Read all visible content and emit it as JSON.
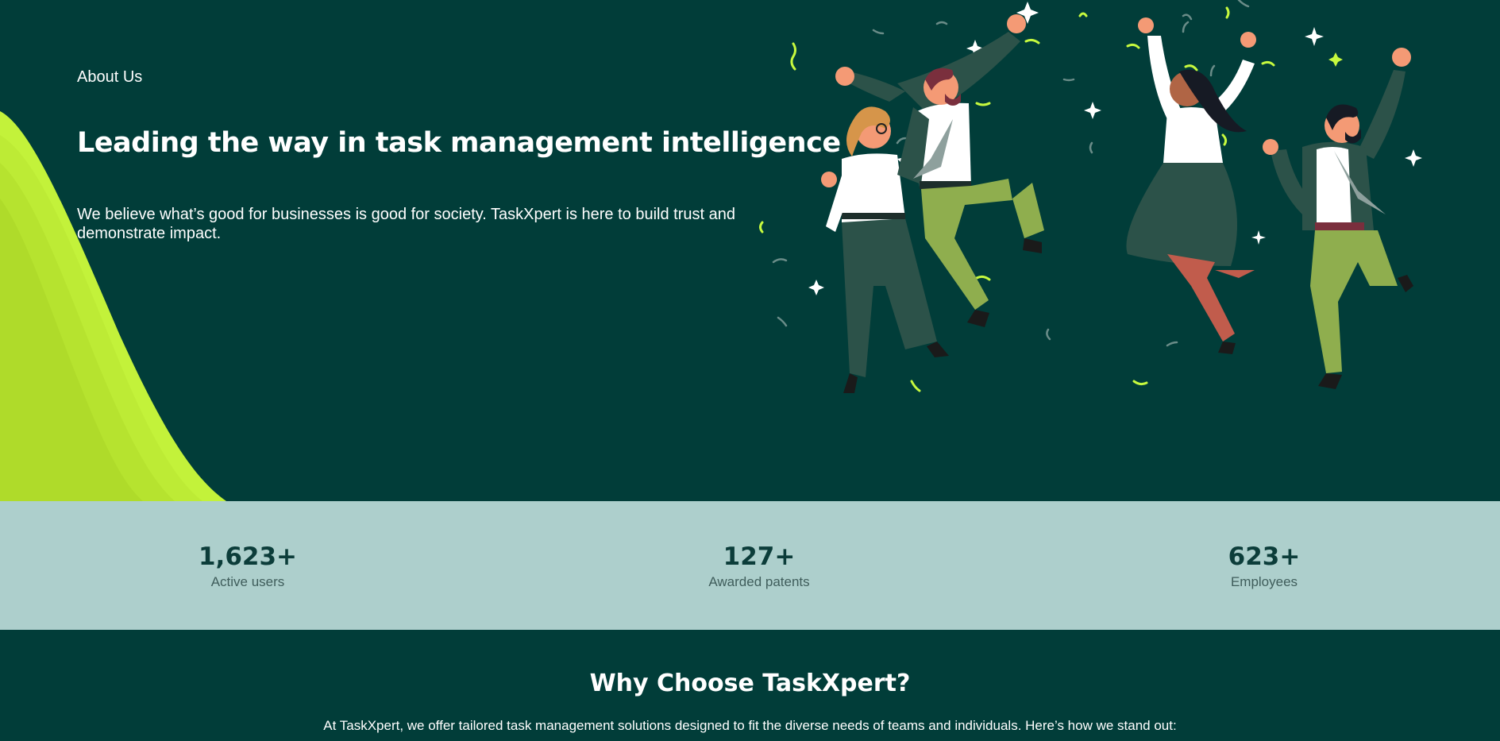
{
  "hero": {
    "eyebrow": "About Us",
    "title": "Leading the way in task management intelligence",
    "description": "We believe what’s good for businesses is good for society. TaskXpert is here to build trust and demonstrate impact.",
    "illustration": "people-jumping-celebration-illustration"
  },
  "stats": [
    {
      "value": "1,623+",
      "label": "Active users"
    },
    {
      "value": "127+",
      "label": "Awarded patents"
    },
    {
      "value": "623+",
      "label": "Employees"
    }
  ],
  "why": {
    "title": "Why Choose TaskXpert?",
    "intro": "At TaskXpert, we offer tailored task management solutions designed to fit the diverse needs of teams and individuals. Here’s how we stand out:"
  },
  "colors": {
    "background": "#013d39",
    "accent": "#c6f93e",
    "stats_band": "#adcfcc",
    "text": "#ffffff"
  }
}
